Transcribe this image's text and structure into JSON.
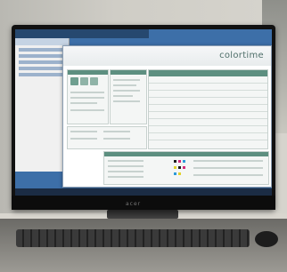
{
  "logo": {
    "text": "colortime",
    "subtitle": ""
  },
  "monitor": {
    "brand": "acer"
  },
  "taskbar": {
    "clock": ""
  },
  "colors": {
    "brand": "#4f6f6a",
    "accent": "#5d8f80",
    "desktop": "#3d6fa8"
  },
  "icons": [
    "windows-icon",
    "toolbar-icon",
    "keyboard",
    "mouse"
  ]
}
